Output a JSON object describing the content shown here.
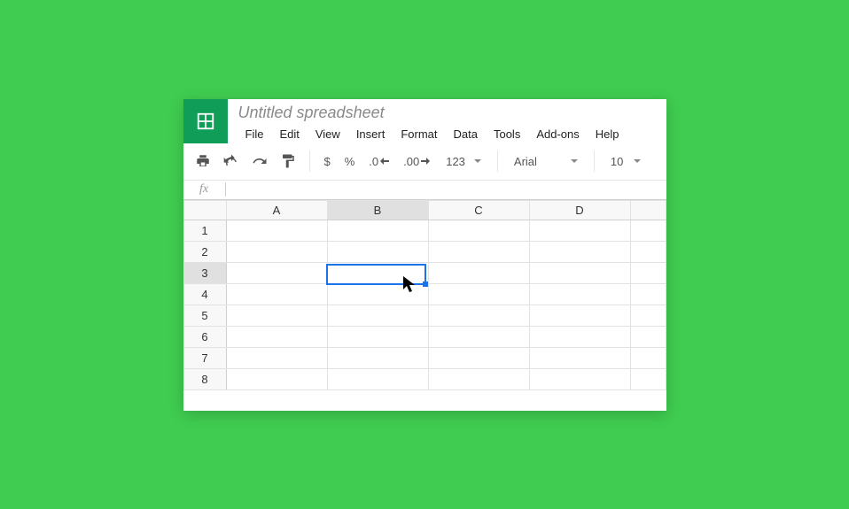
{
  "title": "Untitled spreadsheet",
  "menu": [
    "File",
    "Edit",
    "View",
    "Insert",
    "Format",
    "Data",
    "Tools",
    "Add-ons",
    "Help"
  ],
  "toolbar": {
    "currency": "$",
    "percent": "%",
    "dec_dec": ".0",
    "inc_dec": ".00",
    "more_formats": "123",
    "font": "Arial",
    "size": "10"
  },
  "fx": "fx",
  "columns": [
    "A",
    "B",
    "C",
    "D"
  ],
  "rows": [
    "1",
    "2",
    "3",
    "4",
    "5",
    "6",
    "7",
    "8"
  ],
  "selected": {
    "col": "B",
    "row": "3"
  },
  "colors": {
    "brand": "#0f9d58",
    "select": "#1a73e8"
  }
}
